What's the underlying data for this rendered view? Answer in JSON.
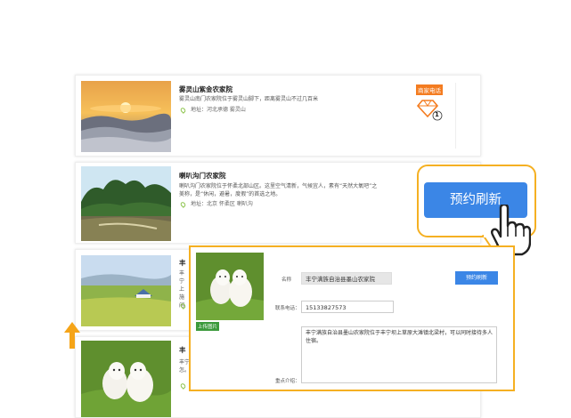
{
  "listings": [
    {
      "title": "雾灵山紫金农家院",
      "description": "雾灵山南门农家院位于雾灵山脚下，距离雾灵山不过几百米",
      "address": "地址：河北承德 雾灵山",
      "tag": "商家电话",
      "badge_count": "1"
    },
    {
      "title": "喇叭沟门农家院",
      "description": "喇叭沟门农家院位于怀柔北部山区。这里空气清新，气候宜人，素有“天然大氧吧”之美称，是“休闲，避暑，度假”的首选之地。",
      "address": "地址：北京 怀柔区 喇叭沟"
    },
    {
      "title_fragment": "丰",
      "lines": [
        "丰宁",
        "上",
        "施闲"
      ]
    },
    {
      "title_fragment": "丰",
      "lines": [
        "丰宁",
        "怎。"
      ]
    }
  ],
  "callout": {
    "button_label": "预约刷新"
  },
  "editor": {
    "upload_label": "上传图片",
    "name_label": "名称",
    "name_value": "丰宁满族自治县墨山农家院",
    "refresh_button": "预约刷新",
    "phone_label": "联系电话：",
    "phone_value": "15133827573",
    "intro_label": "重点介绍：",
    "intro_value": "丰宁满族自治县墨山农家院位于丰宁坝上草原大滩镇北梁村，可以同时接待多人住宿。"
  },
  "colors": {
    "accent_orange": "#f5b022",
    "tag_orange": "#f47c20",
    "button_blue": "#3b86e6"
  },
  "icons": {
    "location": "location-pin-icon",
    "diamond": "diamond-icon",
    "cursor": "hand-pointer-icon",
    "arrow": "up-arrow-icon"
  }
}
